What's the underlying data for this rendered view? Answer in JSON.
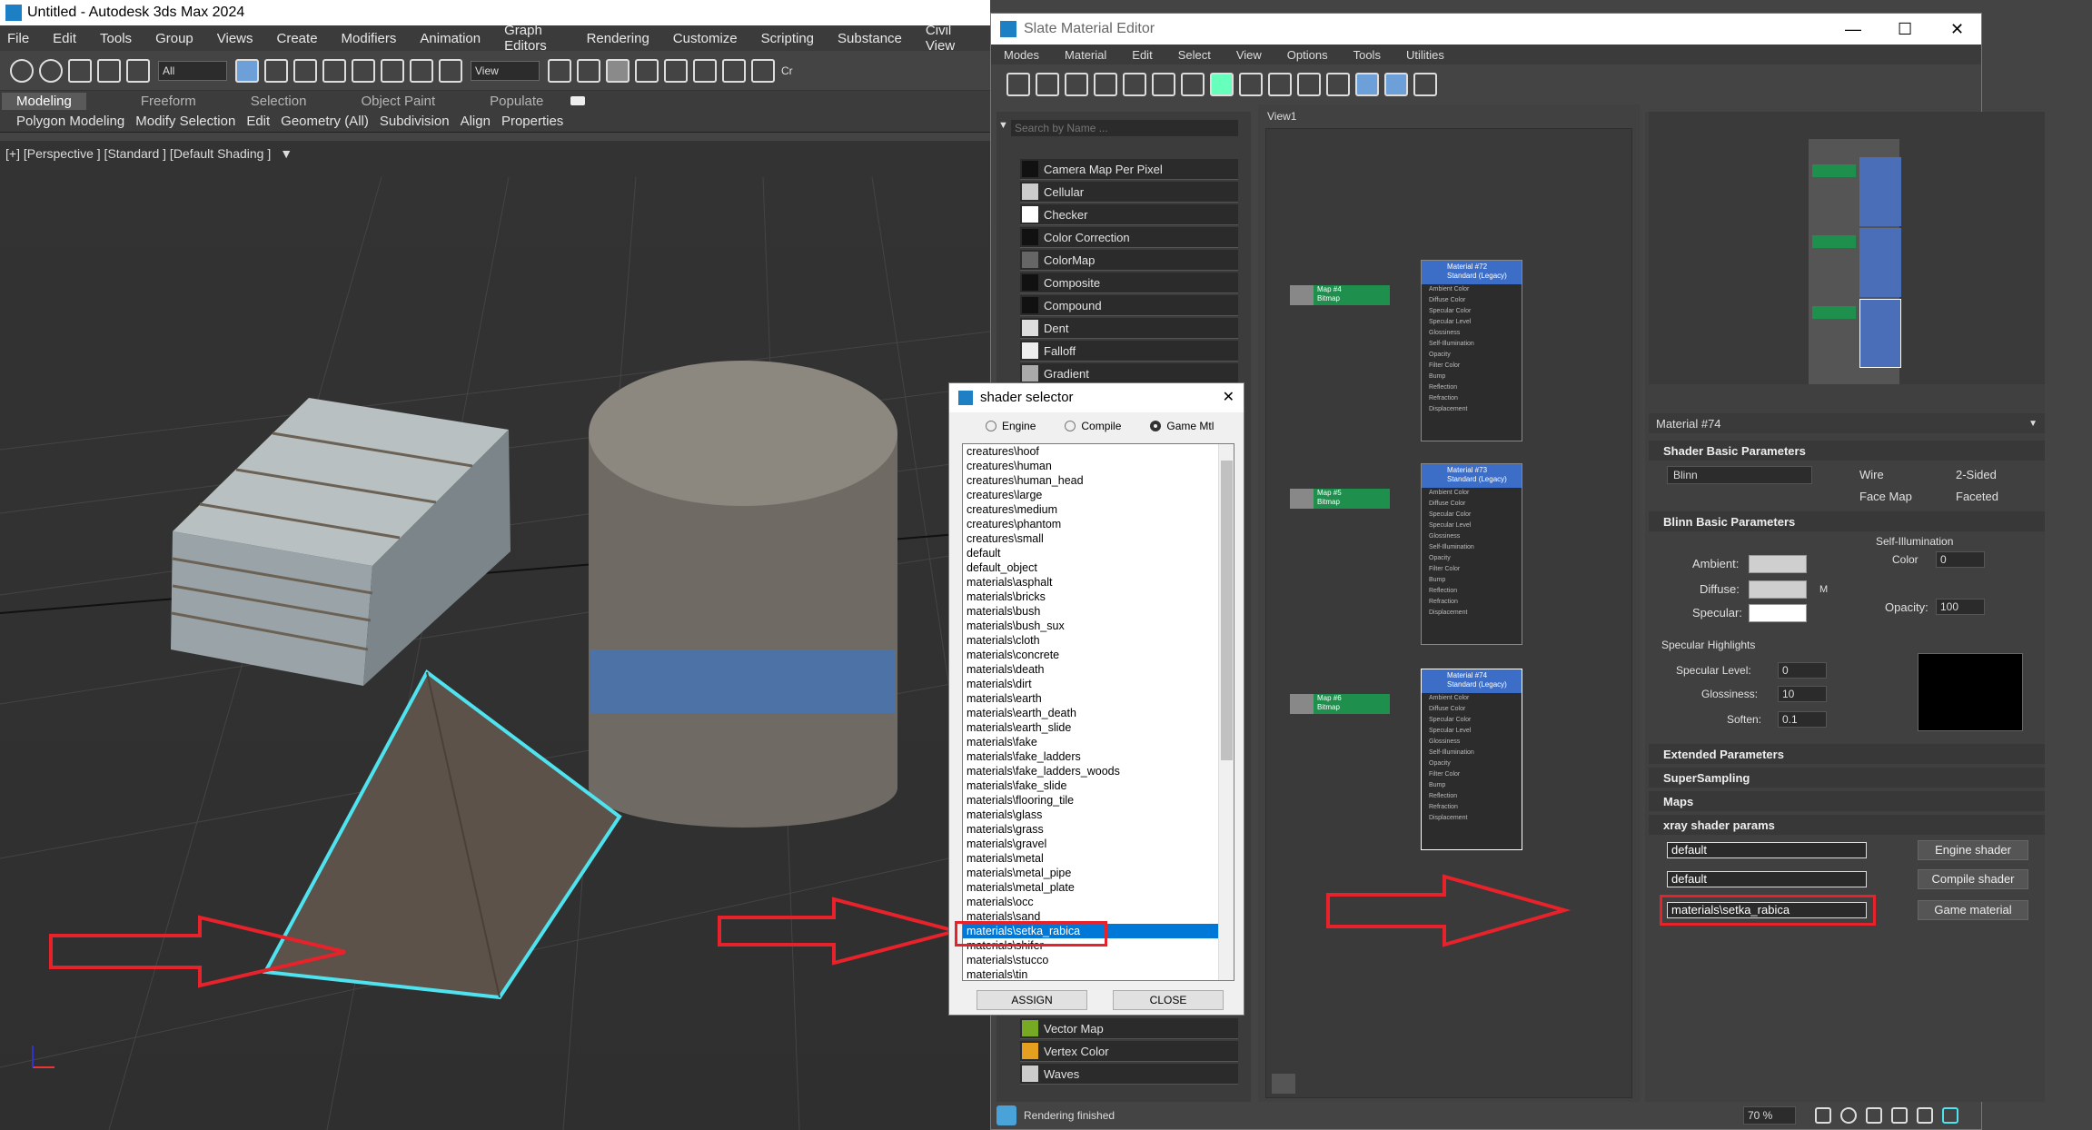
{
  "main": {
    "title": "Untitled - Autodesk 3ds Max 2024",
    "menu": [
      "File",
      "Edit",
      "Tools",
      "Group",
      "Views",
      "Create",
      "Modifiers",
      "Animation",
      "Graph Editors",
      "Rendering",
      "Customize",
      "Scripting",
      "Substance",
      "Civil View"
    ],
    "toolbar": {
      "filter": "All",
      "view_dropdown": "View",
      "partial_label": "Cr"
    },
    "ribbon_tabs": [
      "Modeling",
      "Freeform",
      "Selection",
      "Object Paint",
      "Populate"
    ],
    "ribbon_sub": [
      "Polygon Modeling",
      "Modify Selection",
      "Edit",
      "Geometry (All)",
      "Subdivision",
      "Align",
      "Properties"
    ],
    "viewport_label": "[+] [Perspective ] [Standard ] [Default Shading ]"
  },
  "slate": {
    "title": "Slate Material Editor",
    "menu": [
      "Modes",
      "Material",
      "Edit",
      "Select",
      "View",
      "Options",
      "Tools",
      "Utilities"
    ],
    "search_placeholder": "Search by Name ...",
    "maps": [
      "Camera Map Per Pixel",
      "Cellular",
      "Checker",
      "Color Correction",
      "ColorMap",
      "Composite",
      "Compound",
      "Dent",
      "Falloff",
      "Gradient"
    ],
    "maps_bottom": [
      "Vector Map",
      "Vertex Color",
      "Waves"
    ],
    "view_tab": "View1",
    "nodes": [
      {
        "map_label": "Map #4",
        "map_sub": "Bitmap",
        "mat_label": "Material #72",
        "mat_sub": "Standard (Legacy)"
      },
      {
        "map_label": "Map #5",
        "map_sub": "Bitmap",
        "mat_label": "Material #73",
        "mat_sub": "Standard (Legacy)"
      },
      {
        "map_label": "Map #6",
        "map_sub": "Bitmap",
        "mat_label": "Material #74",
        "mat_sub": "Standard (Legacy)"
      }
    ],
    "slots": [
      "Ambient Color",
      "Diffuse Color",
      "Specular Color",
      "Specular Level",
      "Glossiness",
      "Self-Illumination",
      "Opacity",
      "Filter Color",
      "Bump",
      "Reflection",
      "Refraction",
      "Displacement"
    ],
    "material_name": "Material #74",
    "shader_basic": {
      "title": "Shader Basic Parameters",
      "shader": "Blinn",
      "wire": "Wire",
      "two_sided": "2-Sided",
      "face_map": "Face Map",
      "faceted": "Faceted"
    },
    "blinn": {
      "title": "Blinn Basic Parameters",
      "self_illum": "Self-Illumination",
      "color": "Color",
      "color_val": "0",
      "ambient": "Ambient:",
      "diffuse": "Diffuse:",
      "specular": "Specular:",
      "m": "M",
      "opacity": "Opacity:",
      "opacity_val": "100"
    },
    "spec_highlights": {
      "title": "Specular Highlights",
      "level": "Specular Level:",
      "level_val": "0",
      "gloss": "Glossiness:",
      "gloss_val": "10",
      "soften": "Soften:",
      "soften_val": "0.1"
    },
    "rollouts": [
      "Extended Parameters",
      "SuperSampling",
      "Maps",
      "xray shader params"
    ],
    "xray": {
      "field1": "default",
      "field2": "default",
      "field3": "materials\\setka_rabica",
      "btn1": "Engine shader",
      "btn2": "Compile shader",
      "btn3": "Game material"
    },
    "status": "Rendering finished",
    "zoom": "70 %"
  },
  "dialog": {
    "title": "shader selector",
    "radios": [
      "Engine",
      "Compile",
      "Game Mtl"
    ],
    "items": [
      "creatures\\hoof",
      "creatures\\human",
      "creatures\\human_head",
      "creatures\\large",
      "creatures\\medium",
      "creatures\\phantom",
      "creatures\\small",
      "default",
      "default_object",
      "materials\\asphalt",
      "materials\\bricks",
      "materials\\bush",
      "materials\\bush_sux",
      "materials\\cloth",
      "materials\\concrete",
      "materials\\death",
      "materials\\dirt",
      "materials\\earth",
      "materials\\earth_death",
      "materials\\earth_slide",
      "materials\\fake",
      "materials\\fake_ladders",
      "materials\\fake_ladders_woods",
      "materials\\fake_slide",
      "materials\\flooring_tile",
      "materials\\glass",
      "materials\\grass",
      "materials\\gravel",
      "materials\\metal",
      "materials\\metal_pipe",
      "materials\\metal_plate",
      "materials\\occ",
      "materials\\sand",
      "materials\\setka_rabica",
      "materials\\shifer",
      "materials\\stucco",
      "materials\\tin"
    ],
    "selected_index": 33,
    "assign": "ASSIGN",
    "close": "CLOSE"
  }
}
